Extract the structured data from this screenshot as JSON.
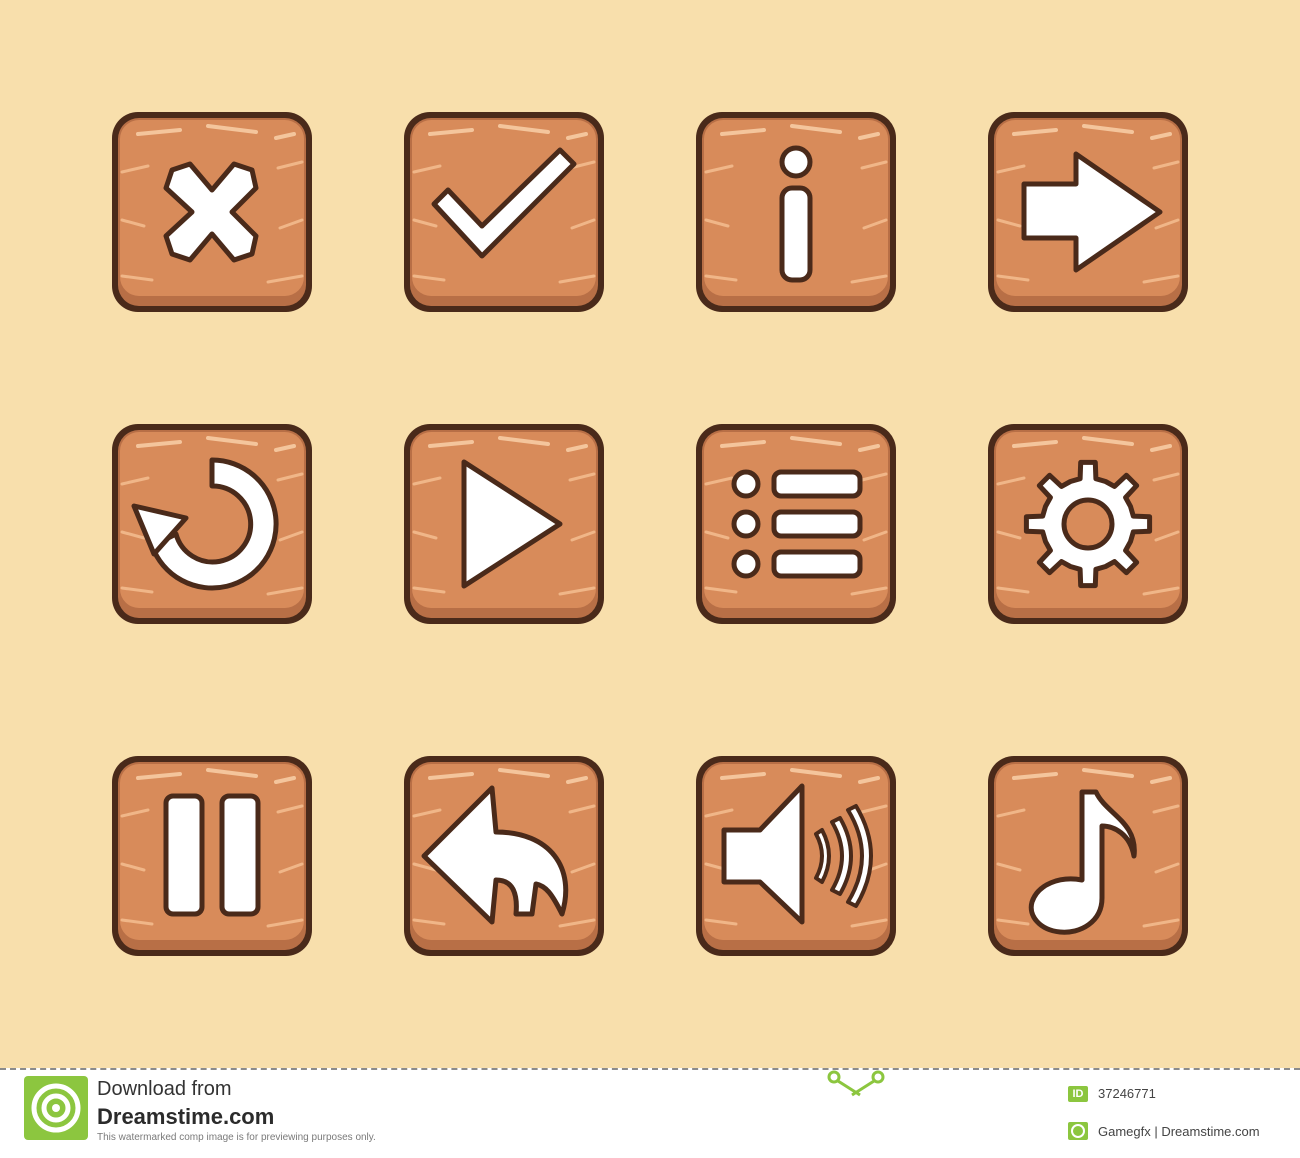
{
  "buttons": [
    {
      "name": "close-button",
      "icon": "close-icon"
    },
    {
      "name": "confirm-button",
      "icon": "checkmark-icon"
    },
    {
      "name": "info-button",
      "icon": "info-icon"
    },
    {
      "name": "next-button",
      "icon": "arrow-right-icon"
    },
    {
      "name": "restart-button",
      "icon": "restart-icon"
    },
    {
      "name": "play-button",
      "icon": "play-icon"
    },
    {
      "name": "menu-button",
      "icon": "list-icon"
    },
    {
      "name": "settings-button",
      "icon": "gear-icon"
    },
    {
      "name": "pause-button",
      "icon": "pause-icon"
    },
    {
      "name": "back-button",
      "icon": "back-arrow-icon"
    },
    {
      "name": "sound-button",
      "icon": "speaker-icon"
    },
    {
      "name": "music-button",
      "icon": "music-note-icon"
    }
  ],
  "colors": {
    "background": "#f8dfac",
    "tile_fill": "#d88b5a",
    "tile_outline": "#4a2a1a",
    "icon_fill": "#ffffff"
  },
  "footer": {
    "download_from": "Download from",
    "site": "Dreamstime.com",
    "note": "This watermarked comp image is for previewing purposes only.",
    "id_label": "ID",
    "id_value": "37246771",
    "credit": "Gamegfx | Dreamstime.com"
  }
}
